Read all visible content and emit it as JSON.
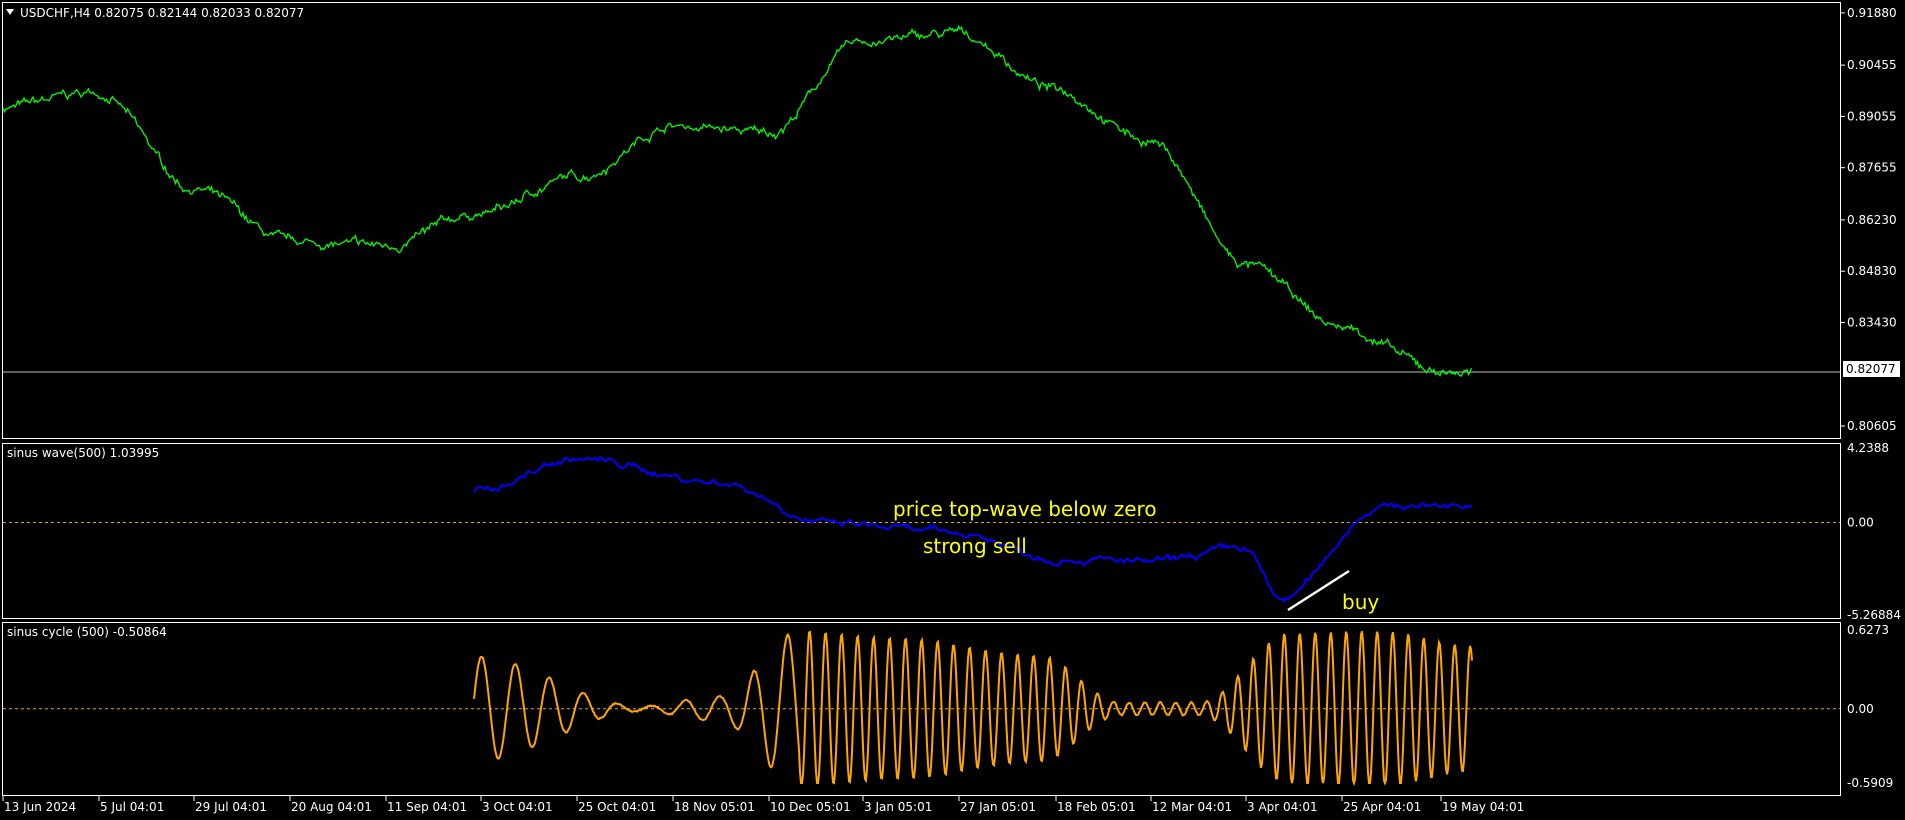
{
  "header": {
    "symbol_label": "USDCHF,H4  0.82075 0.82144 0.82033 0.82077",
    "wave_label": "sinus wave(500) 1.03995",
    "cycle_label": "sinus cycle (500) -0.50864"
  },
  "colors": {
    "background": "#000000",
    "price": "#00ff00",
    "wave": "#0000ff",
    "cycle": "#ffa500",
    "annotation": "#ffff00",
    "zero_line": "#daa520",
    "frame": "#ffffff"
  },
  "icons": {
    "symbol_menu": "triangle-down-icon"
  },
  "price_axis": {
    "ticks": [
      "0.91880",
      "0.90455",
      "0.89055",
      "0.87655",
      "0.86230",
      "0.84830",
      "0.83430",
      "0.80605"
    ],
    "tick_values": [
      0.9188,
      0.90455,
      0.89055,
      0.87655,
      0.8623,
      0.8483,
      0.8343,
      0.80605
    ],
    "current_label": "0.82077",
    "current_value": 0.82077
  },
  "wave_axis": {
    "top": "4.2388",
    "zero": "0.00",
    "bottom": "-5.26884"
  },
  "cycle_axis": {
    "top": "0.6273",
    "zero": "0.00",
    "bottom": "-0.5909"
  },
  "time_axis": {
    "labels": [
      "13 Jun 2024",
      "5 Jul 04:01",
      "29 Jul 04:01",
      "20 Aug 04:01",
      "11 Sep 04:01",
      "3 Oct 04:01",
      "25 Oct 04:01",
      "18 Nov 05:01",
      "10 Dec 05:01",
      "3 Jan 05:01",
      "27 Jan 05:01",
      "18 Feb 05:01",
      "12 Mar 04:01",
      "3 Apr 04:01",
      "25 Apr 04:01",
      "19 May 04:01"
    ]
  },
  "annotations": {
    "price_top": "price top-wave below zero",
    "strong_sell": "strong sell",
    "buy": "buy"
  },
  "chart_data": [
    {
      "type": "line",
      "name": "USDCHF,H4",
      "x": [
        "13 Jun 2024",
        "5 Jul 04:01",
        "29 Jul 04:01",
        "20 Aug 04:01",
        "11 Sep 04:01",
        "3 Oct 04:01",
        "25 Oct 04:01",
        "18 Nov 05:01",
        "10 Dec 05:01",
        "3 Jan 05:01",
        "27 Jan 05:01",
        "18 Feb 05:01",
        "12 Mar 04:01",
        "3 Apr 04:01",
        "25 Apr 04:01",
        "19 May 04:01"
      ],
      "values": [
        0.893,
        0.897,
        0.871,
        0.856,
        0.855,
        0.864,
        0.874,
        0.888,
        0.886,
        0.911,
        0.913,
        0.898,
        0.884,
        0.85,
        0.833,
        0.821
      ],
      "ylim": [
        0.8025,
        0.9215
      ],
      "last_value": 0.82077
    },
    {
      "type": "line",
      "name": "sinus wave(500)",
      "x": [
        "3 Oct 04:01",
        "25 Oct 04:01",
        "18 Nov 05:01",
        "10 Dec 05:01",
        "3 Jan 05:01",
        "27 Jan 05:01",
        "18 Feb 05:01",
        "12 Mar 04:01",
        "3 Apr 04:01",
        "25 Apr 04:01",
        "19 May 04:01"
      ],
      "values": [
        1.8,
        3.6,
        2.3,
        -0.1,
        -0.6,
        -2.0,
        -2.3,
        -1.5,
        -4.4,
        0.9,
        1.04
      ],
      "ylim": [
        -5.26884,
        4.2388
      ],
      "last_value": 1.03995
    },
    {
      "type": "line",
      "name": "sinus cycle (500)",
      "x": [
        "3 Oct 04:01",
        "25 Oct 04:01",
        "18 Nov 05:01",
        "10 Dec 05:01",
        "3 Jan 05:01",
        "27 Jan 05:01",
        "18 Feb 05:01",
        "12 Mar 04:01",
        "3 Apr 04:01",
        "25 Apr 04:01",
        "19 May 04:01"
      ],
      "amplitude_segments": [
        0.42,
        0.02,
        0.1,
        0.62,
        0.56,
        0.42,
        0.05,
        0.05,
        0.6,
        0.62,
        0.5
      ],
      "ylim": [
        -0.5909,
        0.6273
      ],
      "last_value": -0.50864
    }
  ]
}
